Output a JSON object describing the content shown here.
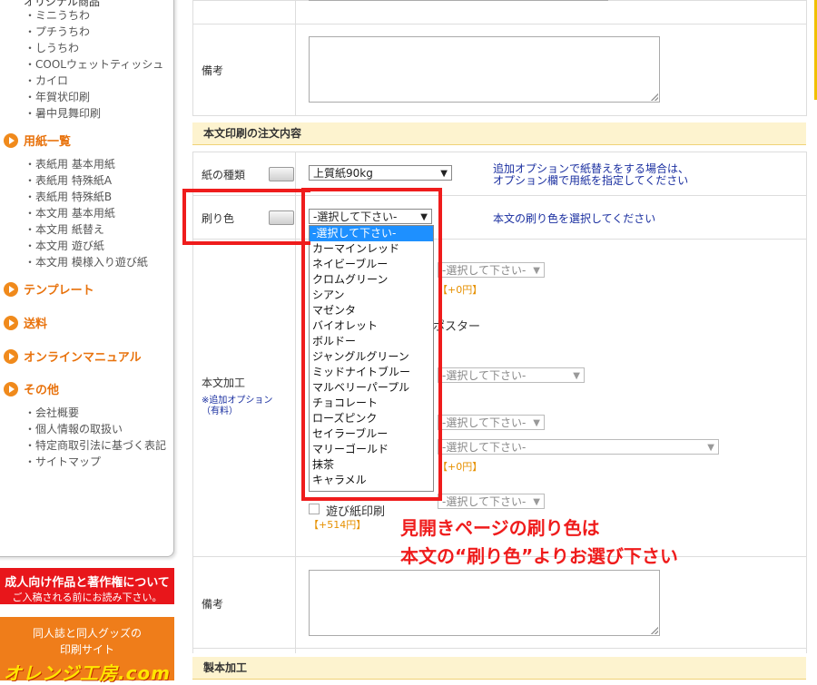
{
  "sidebar": {
    "top_partial": "オリジナル商品",
    "group1": [
      "・ミニうちわ",
      "・プチうちわ",
      "・しうちわ",
      "・COOLウェットティッシュ",
      "・カイロ",
      "・年賀状印刷",
      "・暑中見舞印刷"
    ],
    "cat_paper": "用紙一覧",
    "group2": [
      "・表紙用 基本用紙",
      "・表紙用 特殊紙A",
      "・表紙用 特殊紙B",
      "・本文用 基本用紙",
      "・本文用 紙替え",
      "・本文用 遊び紙",
      "・本文用 模様入り遊び紙"
    ],
    "cat_template": "テンプレート",
    "cat_shipping": "送料",
    "cat_manual": "オンラインマニュアル",
    "cat_other": "その他",
    "group3": [
      "・会社概要",
      "・個人情報の取扱い",
      "・特定商取引法に基づく表記",
      "・サイトマップ"
    ]
  },
  "banners": {
    "b1_line1": "成人向け作品と著作権について",
    "b1_line2": "ご入稿される前にお読み下さい。",
    "b2_line1": "同人誌と同人グッズの",
    "b2_line2": "印刷サイト",
    "b2_logo": "オレンジ工房.com"
  },
  "form": {
    "bikou_label": "備考",
    "section_honbun": "本文印刷の注文内容",
    "paper_type_label": "紙の種類",
    "paper_type_value": "上質紙90kg",
    "paper_type_note_1": "追加オプションで紙替えをする場合は、",
    "paper_type_note_2": "オプション欄で用紙を指定してください",
    "ink_color_label": "刷り色",
    "ink_color_value": "-選択して下さい-",
    "ink_color_note": "本文の刷り色を選択してください",
    "honbun_kakou_label": "本文加工",
    "honbun_kakou_sub1": "※追加オプション",
    "honbun_kakou_sub2": "（有料）",
    "opt_select": "-選択して下さい-",
    "opt_price_0": "【+0円】",
    "opt_poster_partial": "ポスター",
    "asobi_label": "遊び紙印刷",
    "asobi_price": "【+514円】",
    "bikou2_label": "備考",
    "section_seihon": "製本加工"
  },
  "dropdown": {
    "options": [
      "-選択して下さい-",
      "カーマインレッド",
      "ネイビーブルー",
      "クロムグリーン",
      "シアン",
      "マゼンタ",
      "バイオレット",
      "ボルドー",
      "ジャングルグリーン",
      "ミッドナイトブルー",
      "マルベリーパープル",
      "チョコレート",
      "ローズピンク",
      "セイラーブルー",
      "マリーゴールド",
      "抹茶",
      "キャラメル"
    ],
    "selected_index": 0
  },
  "annotation": {
    "line1": "見開きページの刷り色は",
    "line2": "本文の“刷り色”よりお選び下さい"
  },
  "colors": {
    "accent_orange": "#ef7d1a",
    "section_bg": "#fdf3cf",
    "annotation_red": "#ef1c1c",
    "note_blue": "#1a2fa0",
    "selected_blue": "#1e90ff"
  }
}
